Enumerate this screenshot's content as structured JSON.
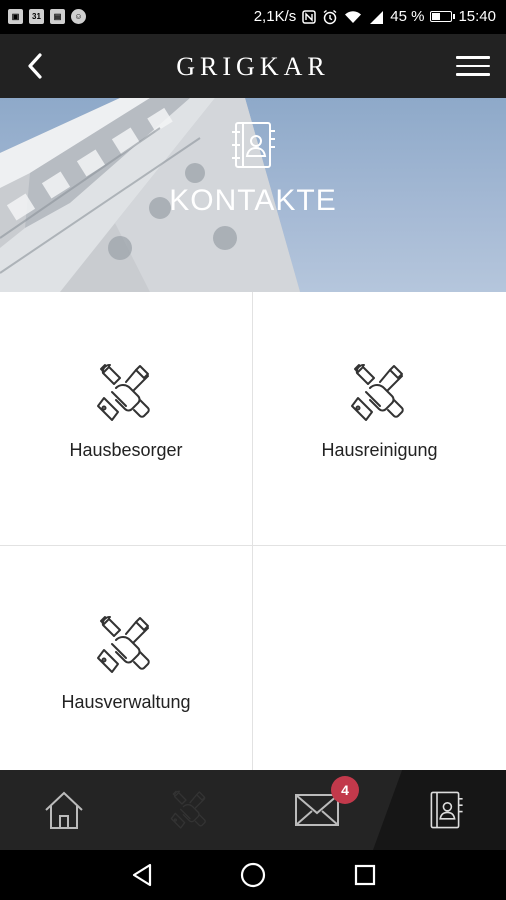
{
  "status_bar": {
    "left_icons": [
      "image-icon",
      "calendar-icon",
      "store-icon",
      "settings-icon"
    ],
    "calendar_day": "31",
    "network_speed": "2,1K/s",
    "battery_percent": "45 %",
    "battery_level": 0.45,
    "time": "15:40"
  },
  "app_bar": {
    "title": "GRIGKAR",
    "back_icon": "chevron-left-icon",
    "menu_icon": "hamburger-menu-icon"
  },
  "banner": {
    "title": "KONTAKTE",
    "icon": "address-book-icon"
  },
  "contacts": [
    {
      "label": "Hausbesorger",
      "icon": "tools-hand-icon"
    },
    {
      "label": "Hausreinigung",
      "icon": "tools-hand-icon"
    },
    {
      "label": "Hausverwaltung",
      "icon": "tools-hand-icon"
    }
  ],
  "bottom_nav": {
    "items": [
      {
        "name": "home",
        "icon": "home-icon"
      },
      {
        "name": "services",
        "icon": "tools-hand-icon"
      },
      {
        "name": "messages",
        "icon": "mail-icon"
      },
      {
        "name": "contacts",
        "icon": "address-book-icon",
        "active": true
      }
    ],
    "mail_badge": "4"
  },
  "system_nav": [
    "back-triangle-icon",
    "home-circle-icon",
    "recents-square-icon"
  ],
  "colors": {
    "app_bar": "#222222",
    "bottom_nav": "#242424",
    "badge": "#c2394b",
    "banner_sky": "#a6bad5"
  }
}
